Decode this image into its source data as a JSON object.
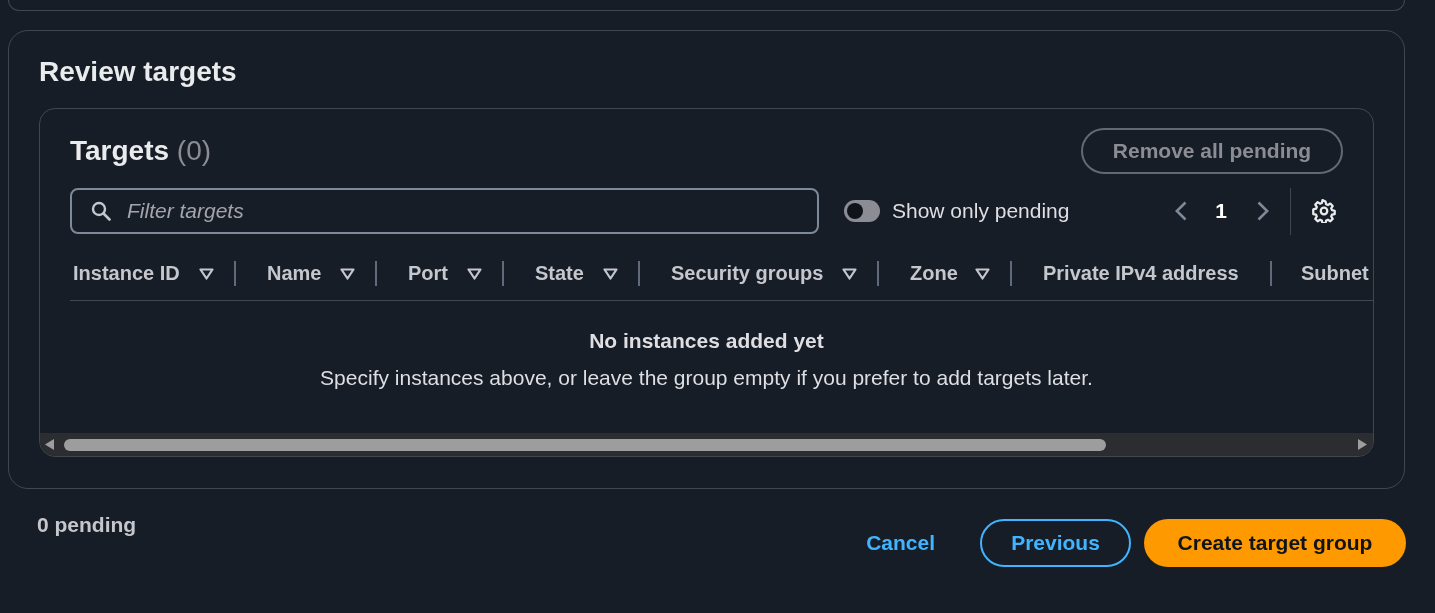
{
  "review": {
    "title": "Review targets",
    "targets": {
      "title": "Targets",
      "count": "(0)",
      "remove_button": {
        "label": "Remove all pending",
        "disabled": true
      },
      "filter": {
        "placeholder": "Filter targets"
      },
      "pending_toggle": {
        "label": "Show only pending",
        "on": false
      },
      "pagination": {
        "previous_disabled": true,
        "pages": [
          {
            "label": "1",
            "selected": true
          }
        ],
        "next_disabled": true
      },
      "columns": [
        {
          "label": "Instance ID",
          "sortable": true
        },
        {
          "label": "Name",
          "sortable": true
        },
        {
          "label": "Port",
          "sortable": true
        },
        {
          "label": "State",
          "sortable": true
        },
        {
          "label": "Security groups",
          "sortable": true
        },
        {
          "label": "Zone",
          "sortable": true
        },
        {
          "label": "Private IPv4 address",
          "sortable": false
        },
        {
          "label": "Subnet",
          "sortable": false
        }
      ],
      "empty_state": {
        "title": "No instances added yet",
        "description": "Specify instances above, or leave the group empty if you prefer to add targets later."
      }
    }
  },
  "footer": {
    "pending": "0 pending",
    "buttons": [
      {
        "label": "Cancel",
        "kind": "link"
      },
      {
        "label": "Previous",
        "kind": "secondary"
      },
      {
        "label": "Create target group",
        "kind": "primary"
      }
    ]
  }
}
